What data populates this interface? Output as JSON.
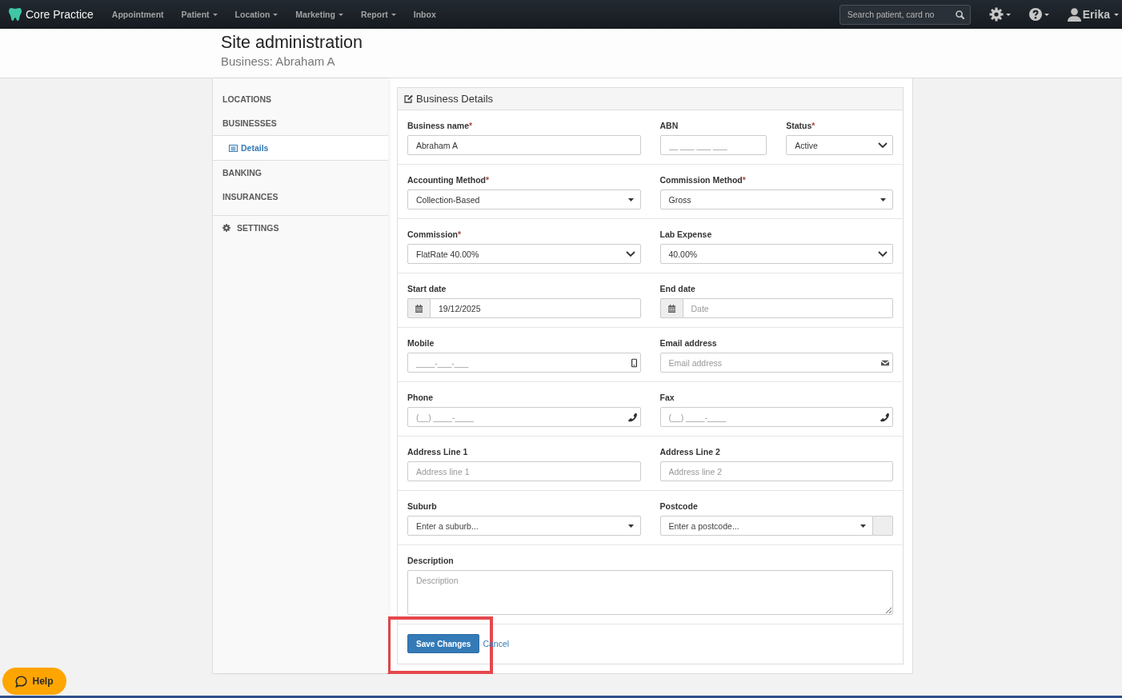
{
  "navbar": {
    "brand": "Core Practice",
    "menu": [
      {
        "label": "Appointment",
        "dropdown": false
      },
      {
        "label": "Patient",
        "dropdown": true
      },
      {
        "label": "Location",
        "dropdown": true
      },
      {
        "label": "Marketing",
        "dropdown": true
      },
      {
        "label": "Report",
        "dropdown": true
      },
      {
        "label": "Inbox",
        "dropdown": false
      }
    ],
    "search": {
      "placeholder": "Search patient, card no"
    },
    "user": {
      "name": "Erika"
    }
  },
  "header": {
    "title": "Site administration",
    "subtitle": "Business: Abraham A"
  },
  "sidebar": {
    "groups": [
      {
        "items": [
          {
            "label": "LOCATIONS",
            "kind": "plain",
            "selected": false
          },
          {
            "label": "BUSINESSES",
            "kind": "plain",
            "selected": false,
            "children": [
              {
                "label": "Details",
                "selected": true
              }
            ]
          },
          {
            "label": "BANKING",
            "kind": "plain",
            "selected": false
          },
          {
            "label": "INSURANCES",
            "kind": "plain",
            "selected": false
          }
        ]
      },
      {
        "items": [
          {
            "label": "SETTINGS",
            "kind": "settings",
            "selected": false
          }
        ]
      }
    ]
  },
  "form": {
    "title": "Business Details",
    "rows": [
      {
        "fields": [
          {
            "label": "Business name",
            "required_mark": "*",
            "kind": "text",
            "value": "Abraham A"
          },
          {
            "label": "ABN",
            "kind": "text",
            "placeholder": "__ ___ ___ ___"
          },
          {
            "label": "Status",
            "required_mark": "*",
            "kind": "select",
            "value": "Active"
          }
        ]
      },
      {
        "fields": [
          {
            "label": "Accounting Method",
            "required_mark": "*",
            "kind": "dropdown",
            "value": "Collection-Based"
          },
          {
            "label": "Commission Method",
            "required_mark": "*",
            "kind": "dropdown",
            "value": "Gross"
          }
        ]
      },
      {
        "fields": [
          {
            "label": "Commission",
            "required_mark": "*",
            "kind": "select",
            "value": "FlatRate 40.00%"
          },
          {
            "label": "Lab Expense",
            "kind": "select",
            "value": "40.00%"
          }
        ]
      },
      {
        "fields": [
          {
            "label": "Start date",
            "kind": "date",
            "value": "19/12/2025"
          },
          {
            "label": "End date",
            "kind": "date",
            "placeholder": "Date"
          }
        ]
      },
      {
        "fields": [
          {
            "label": "Mobile",
            "kind": "mobile",
            "placeholder": "____-___-___"
          },
          {
            "label": "Email address",
            "kind": "email",
            "placeholder": "Email address"
          }
        ]
      },
      {
        "fields": [
          {
            "label": "Phone",
            "kind": "phone",
            "placeholder": "(__) ____-____"
          },
          {
            "label": "Fax",
            "kind": "phone",
            "placeholder": "(__) ____-____"
          }
        ]
      },
      {
        "fields": [
          {
            "label": "Address Line 1",
            "kind": "text",
            "placeholder": "Address line 1"
          },
          {
            "label": "Address Line 2",
            "kind": "text",
            "placeholder": "Address line 2"
          }
        ]
      },
      {
        "fields": [
          {
            "label": "Suburb",
            "kind": "dropdown",
            "placeholder": "Enter a suburb..."
          },
          {
            "label": "Postcode",
            "kind": "lookup",
            "placeholder": "Enter a postcode..."
          }
        ]
      },
      {
        "fields": [
          {
            "label": "Description",
            "kind": "textarea",
            "placeholder": "Description"
          }
        ]
      }
    ],
    "buttons": [
      {
        "label": "Save Changes",
        "kind": "primary",
        "highlighted": true
      },
      {
        "label": "Cancel",
        "kind": "link",
        "highlighted": false
      }
    ]
  },
  "help_button": {
    "label": "Help"
  }
}
